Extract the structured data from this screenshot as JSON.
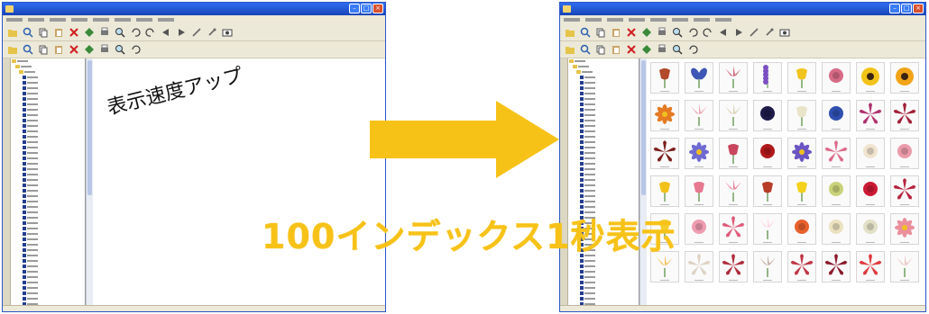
{
  "colors": {
    "accent": "#f7c218",
    "titlebar": "#1f56d6",
    "tree_leaf": "#233d8f",
    "folder": "#e6c44a"
  },
  "left_caption": "表示速度アップ",
  "big_caption": "100インデックス1秒表示",
  "window": {
    "title": "",
    "menu": [
      "",
      "",
      "",
      "",
      "",
      "",
      "",
      ""
    ]
  },
  "toolbar_icons": [
    "folder-icon",
    "search-icon",
    "copy-icon",
    "paste-icon",
    "delete-icon",
    "move-icon",
    "print-icon",
    "zoom-icon",
    "undo-icon",
    "redo-icon",
    "back-icon",
    "forward-icon",
    "pen-icon",
    "tool-icon",
    "camera-icon"
  ],
  "flowers": [
    {
      "shape": "tulip",
      "color": "#b24a2b"
    },
    {
      "shape": "iris",
      "color": "#3e56b5"
    },
    {
      "shape": "lily",
      "color": "#d46a79"
    },
    {
      "shape": "spike",
      "color": "#7b4fc2"
    },
    {
      "shape": "tulip",
      "color": "#f1c31d"
    },
    {
      "shape": "rose",
      "color": "#d86b86"
    },
    {
      "shape": "sun",
      "color": "#f2c318"
    },
    {
      "shape": "sun",
      "color": "#f1a418"
    },
    {
      "shape": "daisy",
      "color": "#e57a22"
    },
    {
      "shape": "lily",
      "color": "#f0a7b7"
    },
    {
      "shape": "lily",
      "color": "#d8d1b0"
    },
    {
      "shape": "rose",
      "color": "#1d1a48"
    },
    {
      "shape": "tulip",
      "color": "#e9e4c8"
    },
    {
      "shape": "rose",
      "color": "#2f4fb0"
    },
    {
      "shape": "star",
      "color": "#b0306f"
    },
    {
      "shape": "star",
      "color": "#a22037"
    },
    {
      "shape": "star",
      "color": "#7c1f1c"
    },
    {
      "shape": "daisy",
      "color": "#6f6bd2"
    },
    {
      "shape": "tulip",
      "color": "#c9455d"
    },
    {
      "shape": "rose",
      "color": "#b0191b"
    },
    {
      "shape": "daisy",
      "color": "#6b54c4"
    },
    {
      "shape": "star",
      "color": "#dc6b8b"
    },
    {
      "shape": "rose",
      "color": "#f1e4cf"
    },
    {
      "shape": "rose",
      "color": "#ec9bab"
    },
    {
      "shape": "tulip",
      "color": "#f2c21a"
    },
    {
      "shape": "tulip",
      "color": "#e6788f"
    },
    {
      "shape": "lily",
      "color": "#e58699"
    },
    {
      "shape": "tulip",
      "color": "#b63c28"
    },
    {
      "shape": "tulip",
      "color": "#f3d11c"
    },
    {
      "shape": "rose",
      "color": "#c9d279"
    },
    {
      "shape": "rose",
      "color": "#cc1a35"
    },
    {
      "shape": "star",
      "color": "#b7243d"
    },
    {
      "shape": "tulip",
      "color": "#f3cd2c"
    },
    {
      "shape": "rose",
      "color": "#ef9cb0"
    },
    {
      "shape": "star",
      "color": "#df5a79"
    },
    {
      "shape": "lily",
      "color": "#ffd8e3"
    },
    {
      "shape": "rose",
      "color": "#e8612c"
    },
    {
      "shape": "rose",
      "color": "#ece2c0"
    },
    {
      "shape": "rose",
      "color": "#e2e0c6"
    },
    {
      "shape": "daisy",
      "color": "#eb8f9d"
    },
    {
      "shape": "lily",
      "color": "#f3c25a"
    },
    {
      "shape": "star",
      "color": "#ddd3c5"
    },
    {
      "shape": "star",
      "color": "#ad2b3b"
    },
    {
      "shape": "lily",
      "color": "#c6b2a6"
    },
    {
      "shape": "star",
      "color": "#c03444"
    },
    {
      "shape": "star",
      "color": "#8a1a2c"
    },
    {
      "shape": "star",
      "color": "#e0393e"
    },
    {
      "shape": "lily",
      "color": "#eac6c0"
    }
  ]
}
